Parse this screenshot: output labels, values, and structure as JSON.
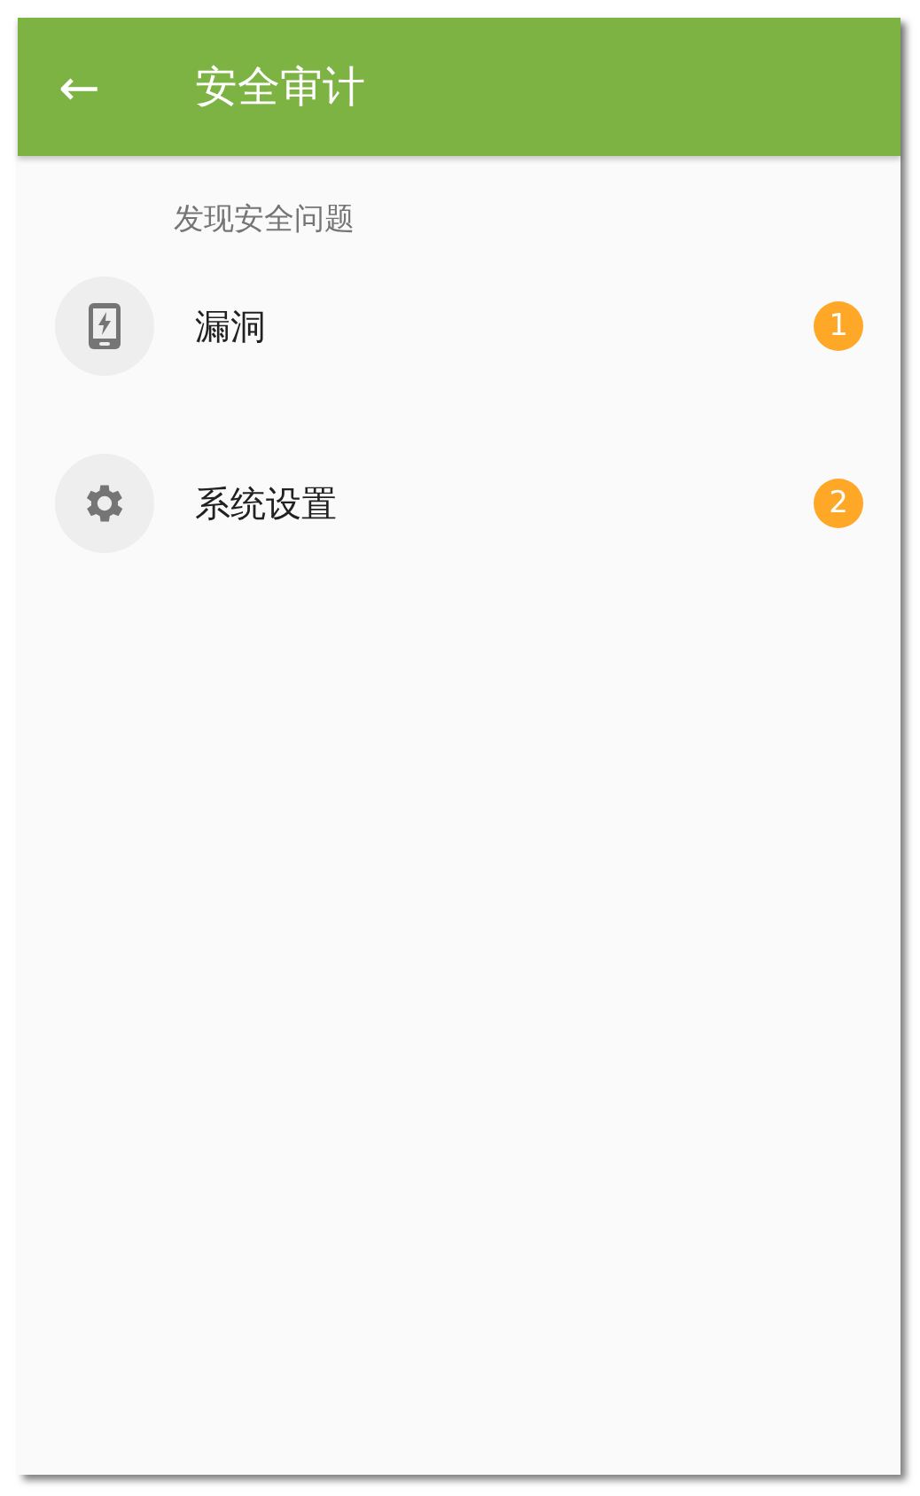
{
  "app_bar": {
    "back_icon": "←",
    "title": "安全审计"
  },
  "section": {
    "header": "发现安全问题"
  },
  "items": [
    {
      "kind": "phone",
      "label": "漏洞",
      "count": "1"
    },
    {
      "kind": "gear",
      "label": "系统设置",
      "count": "2"
    }
  ]
}
